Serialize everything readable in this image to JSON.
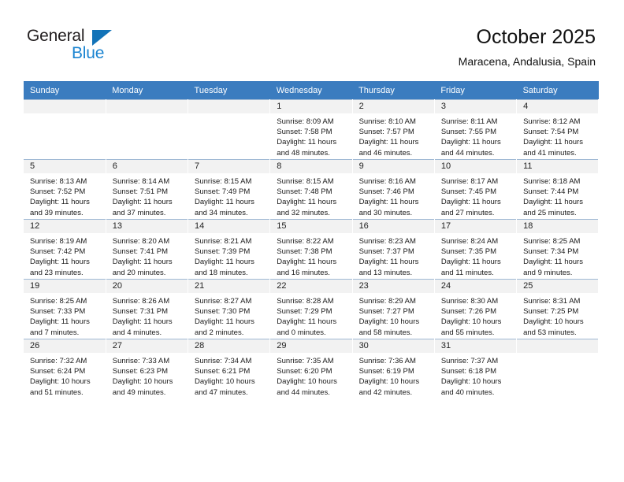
{
  "brand": {
    "name_top": "General",
    "name_bottom": "Blue",
    "accent_color": "#1b84d1",
    "triangle_color": "#1273b8"
  },
  "header": {
    "month_title": "October 2025",
    "location": "Maracena, Andalusia, Spain"
  },
  "theme": {
    "header_row_bg": "#3b7cbf",
    "cell_shade_bg": "#f2f2f2",
    "cell_border": "#9fb9d4"
  },
  "weekdays": [
    "Sunday",
    "Monday",
    "Tuesday",
    "Wednesday",
    "Thursday",
    "Friday",
    "Saturday"
  ],
  "weeks": [
    [
      {
        "day": "",
        "empty": true,
        "sunrise": "",
        "sunset": "",
        "daylight1": "",
        "daylight2": ""
      },
      {
        "day": "",
        "empty": true,
        "sunrise": "",
        "sunset": "",
        "daylight1": "",
        "daylight2": ""
      },
      {
        "day": "",
        "empty": true,
        "sunrise": "",
        "sunset": "",
        "daylight1": "",
        "daylight2": ""
      },
      {
        "day": "1",
        "empty": false,
        "sunrise": "Sunrise: 8:09 AM",
        "sunset": "Sunset: 7:58 PM",
        "daylight1": "Daylight: 11 hours",
        "daylight2": "and 48 minutes."
      },
      {
        "day": "2",
        "empty": false,
        "sunrise": "Sunrise: 8:10 AM",
        "sunset": "Sunset: 7:57 PM",
        "daylight1": "Daylight: 11 hours",
        "daylight2": "and 46 minutes."
      },
      {
        "day": "3",
        "empty": false,
        "sunrise": "Sunrise: 8:11 AM",
        "sunset": "Sunset: 7:55 PM",
        "daylight1": "Daylight: 11 hours",
        "daylight2": "and 44 minutes."
      },
      {
        "day": "4",
        "empty": false,
        "sunrise": "Sunrise: 8:12 AM",
        "sunset": "Sunset: 7:54 PM",
        "daylight1": "Daylight: 11 hours",
        "daylight2": "and 41 minutes."
      }
    ],
    [
      {
        "day": "5",
        "empty": false,
        "sunrise": "Sunrise: 8:13 AM",
        "sunset": "Sunset: 7:52 PM",
        "daylight1": "Daylight: 11 hours",
        "daylight2": "and 39 minutes."
      },
      {
        "day": "6",
        "empty": false,
        "sunrise": "Sunrise: 8:14 AM",
        "sunset": "Sunset: 7:51 PM",
        "daylight1": "Daylight: 11 hours",
        "daylight2": "and 37 minutes."
      },
      {
        "day": "7",
        "empty": false,
        "sunrise": "Sunrise: 8:15 AM",
        "sunset": "Sunset: 7:49 PM",
        "daylight1": "Daylight: 11 hours",
        "daylight2": "and 34 minutes."
      },
      {
        "day": "8",
        "empty": false,
        "sunrise": "Sunrise: 8:15 AM",
        "sunset": "Sunset: 7:48 PM",
        "daylight1": "Daylight: 11 hours",
        "daylight2": "and 32 minutes."
      },
      {
        "day": "9",
        "empty": false,
        "sunrise": "Sunrise: 8:16 AM",
        "sunset": "Sunset: 7:46 PM",
        "daylight1": "Daylight: 11 hours",
        "daylight2": "and 30 minutes."
      },
      {
        "day": "10",
        "empty": false,
        "sunrise": "Sunrise: 8:17 AM",
        "sunset": "Sunset: 7:45 PM",
        "daylight1": "Daylight: 11 hours",
        "daylight2": "and 27 minutes."
      },
      {
        "day": "11",
        "empty": false,
        "sunrise": "Sunrise: 8:18 AM",
        "sunset": "Sunset: 7:44 PM",
        "daylight1": "Daylight: 11 hours",
        "daylight2": "and 25 minutes."
      }
    ],
    [
      {
        "day": "12",
        "empty": false,
        "sunrise": "Sunrise: 8:19 AM",
        "sunset": "Sunset: 7:42 PM",
        "daylight1": "Daylight: 11 hours",
        "daylight2": "and 23 minutes."
      },
      {
        "day": "13",
        "empty": false,
        "sunrise": "Sunrise: 8:20 AM",
        "sunset": "Sunset: 7:41 PM",
        "daylight1": "Daylight: 11 hours",
        "daylight2": "and 20 minutes."
      },
      {
        "day": "14",
        "empty": false,
        "sunrise": "Sunrise: 8:21 AM",
        "sunset": "Sunset: 7:39 PM",
        "daylight1": "Daylight: 11 hours",
        "daylight2": "and 18 minutes."
      },
      {
        "day": "15",
        "empty": false,
        "sunrise": "Sunrise: 8:22 AM",
        "sunset": "Sunset: 7:38 PM",
        "daylight1": "Daylight: 11 hours",
        "daylight2": "and 16 minutes."
      },
      {
        "day": "16",
        "empty": false,
        "sunrise": "Sunrise: 8:23 AM",
        "sunset": "Sunset: 7:37 PM",
        "daylight1": "Daylight: 11 hours",
        "daylight2": "and 13 minutes."
      },
      {
        "day": "17",
        "empty": false,
        "sunrise": "Sunrise: 8:24 AM",
        "sunset": "Sunset: 7:35 PM",
        "daylight1": "Daylight: 11 hours",
        "daylight2": "and 11 minutes."
      },
      {
        "day": "18",
        "empty": false,
        "sunrise": "Sunrise: 8:25 AM",
        "sunset": "Sunset: 7:34 PM",
        "daylight1": "Daylight: 11 hours",
        "daylight2": "and 9 minutes."
      }
    ],
    [
      {
        "day": "19",
        "empty": false,
        "sunrise": "Sunrise: 8:25 AM",
        "sunset": "Sunset: 7:33 PM",
        "daylight1": "Daylight: 11 hours",
        "daylight2": "and 7 minutes."
      },
      {
        "day": "20",
        "empty": false,
        "sunrise": "Sunrise: 8:26 AM",
        "sunset": "Sunset: 7:31 PM",
        "daylight1": "Daylight: 11 hours",
        "daylight2": "and 4 minutes."
      },
      {
        "day": "21",
        "empty": false,
        "sunrise": "Sunrise: 8:27 AM",
        "sunset": "Sunset: 7:30 PM",
        "daylight1": "Daylight: 11 hours",
        "daylight2": "and 2 minutes."
      },
      {
        "day": "22",
        "empty": false,
        "sunrise": "Sunrise: 8:28 AM",
        "sunset": "Sunset: 7:29 PM",
        "daylight1": "Daylight: 11 hours",
        "daylight2": "and 0 minutes."
      },
      {
        "day": "23",
        "empty": false,
        "sunrise": "Sunrise: 8:29 AM",
        "sunset": "Sunset: 7:27 PM",
        "daylight1": "Daylight: 10 hours",
        "daylight2": "and 58 minutes."
      },
      {
        "day": "24",
        "empty": false,
        "sunrise": "Sunrise: 8:30 AM",
        "sunset": "Sunset: 7:26 PM",
        "daylight1": "Daylight: 10 hours",
        "daylight2": "and 55 minutes."
      },
      {
        "day": "25",
        "empty": false,
        "sunrise": "Sunrise: 8:31 AM",
        "sunset": "Sunset: 7:25 PM",
        "daylight1": "Daylight: 10 hours",
        "daylight2": "and 53 minutes."
      }
    ],
    [
      {
        "day": "26",
        "empty": false,
        "sunrise": "Sunrise: 7:32 AM",
        "sunset": "Sunset: 6:24 PM",
        "daylight1": "Daylight: 10 hours",
        "daylight2": "and 51 minutes."
      },
      {
        "day": "27",
        "empty": false,
        "sunrise": "Sunrise: 7:33 AM",
        "sunset": "Sunset: 6:23 PM",
        "daylight1": "Daylight: 10 hours",
        "daylight2": "and 49 minutes."
      },
      {
        "day": "28",
        "empty": false,
        "sunrise": "Sunrise: 7:34 AM",
        "sunset": "Sunset: 6:21 PM",
        "daylight1": "Daylight: 10 hours",
        "daylight2": "and 47 minutes."
      },
      {
        "day": "29",
        "empty": false,
        "sunrise": "Sunrise: 7:35 AM",
        "sunset": "Sunset: 6:20 PM",
        "daylight1": "Daylight: 10 hours",
        "daylight2": "and 44 minutes."
      },
      {
        "day": "30",
        "empty": false,
        "sunrise": "Sunrise: 7:36 AM",
        "sunset": "Sunset: 6:19 PM",
        "daylight1": "Daylight: 10 hours",
        "daylight2": "and 42 minutes."
      },
      {
        "day": "31",
        "empty": false,
        "sunrise": "Sunrise: 7:37 AM",
        "sunset": "Sunset: 6:18 PM",
        "daylight1": "Daylight: 10 hours",
        "daylight2": "and 40 minutes."
      },
      {
        "day": "",
        "empty": true,
        "sunrise": "",
        "sunset": "",
        "daylight1": "",
        "daylight2": ""
      }
    ]
  ]
}
